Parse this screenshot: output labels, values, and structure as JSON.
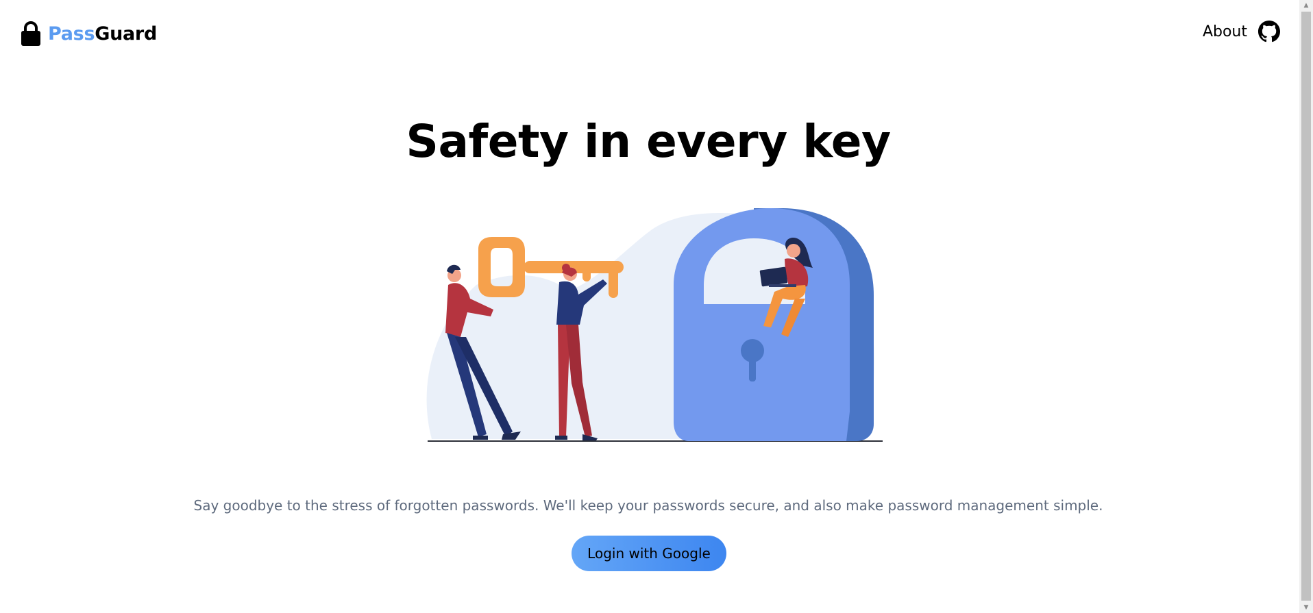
{
  "brand": {
    "name_part1": "Pass",
    "name_part2": "Guard",
    "icon": "lock-icon",
    "accent_color": "#5b9bf0"
  },
  "nav": {
    "about_label": "About",
    "github_icon": "github-icon"
  },
  "hero": {
    "title": "Safety in every key",
    "tagline": "Say goodbye to the stress of forgotten passwords. We'll keep your passwords secure, and also make password management simple.",
    "illustration": "padlock-and-key-people-illustration"
  },
  "cta": {
    "label": "Login with Google",
    "colors": [
      "#64a6f7",
      "#3d86f0"
    ]
  },
  "scrollbar": {
    "up_icon": "scroll-up-arrow-icon",
    "down_icon": "scroll-down-arrow-icon"
  }
}
